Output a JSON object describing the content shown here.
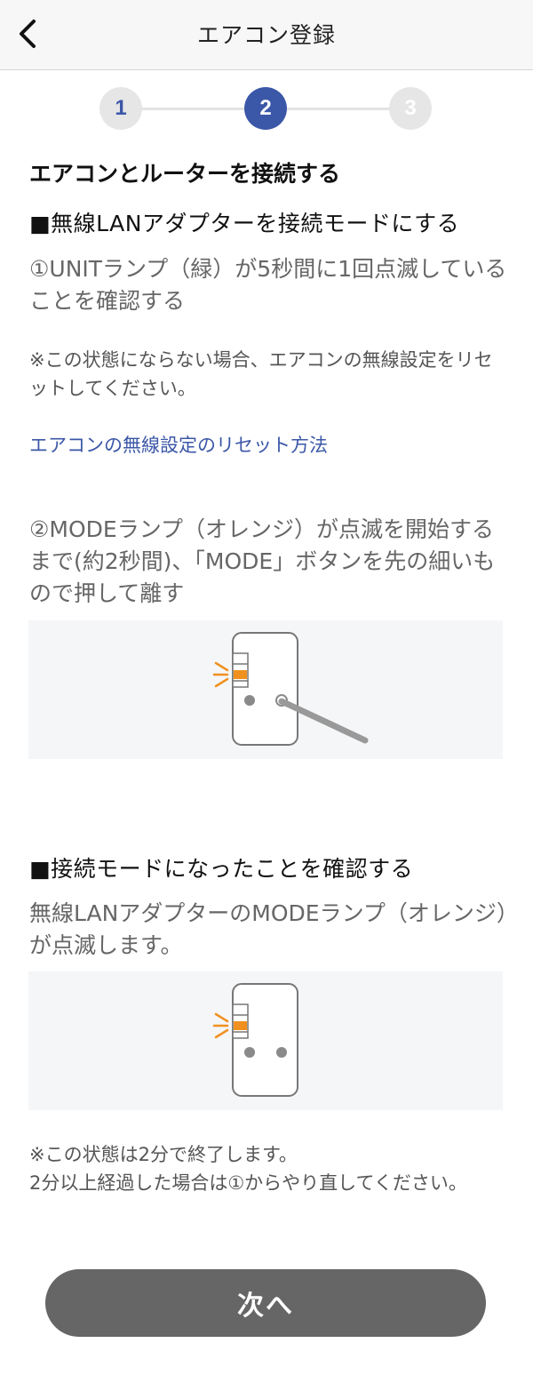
{
  "header": {
    "title": "エアコン登録"
  },
  "stepper": {
    "steps": [
      "1",
      "2",
      "3"
    ],
    "current": 2
  },
  "content": {
    "title": "エアコンとルーターを接続する",
    "section1_heading": "■無線LANアダプターを接続モードにする",
    "step1_text": "①UNITランプ（緑）が5秒間に1回点滅していることを確認する",
    "note1": "※この状態にならない場合、エアコンの無線設定をリセットしてください。",
    "reset_link": "エアコンの無線設定のリセット方法",
    "step2_text": "②MODEランプ（オレンジ）が点滅を開始するまで(約2秒間)、「MODE」ボタンを先の細いもので押して離す",
    "section2_heading": "■接続モードになったことを確認する",
    "confirm_text": "無線LANアダプターのMODEランプ（オレンジ）が点滅します。",
    "note2_line1": "※この状態は2分で終了します。",
    "note2_line2": "2分以上経過した場合は①からやり直してください。"
  },
  "footer": {
    "next_label": "次へ"
  },
  "colors": {
    "accent": "#3b57a7",
    "lamp_orange": "#f0901e",
    "button_gray": "#666666"
  }
}
